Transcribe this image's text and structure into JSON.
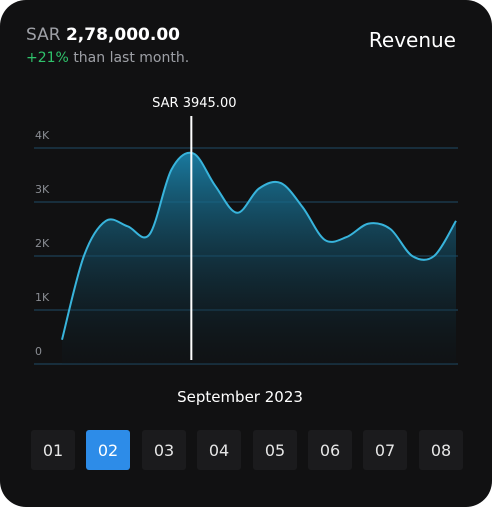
{
  "header": {
    "currency": "SAR",
    "amount": "2,78,000.00",
    "change": "+21%",
    "change_suffix": "than last month.",
    "title": "Revenue"
  },
  "colors": {
    "background": "#111112",
    "accent": "#2d8ce8",
    "line": "#38b4dc",
    "positive": "#2fc26b"
  },
  "tooltip": {
    "label": "SAR 3945.00"
  },
  "chart_data": {
    "type": "area",
    "ytick_labels": [
      "4K",
      "3K",
      "2K",
      "1K",
      "0"
    ],
    "ylim": [
      0,
      4000
    ],
    "x": [
      0,
      1,
      2,
      3,
      4,
      5,
      6,
      7,
      8,
      9,
      10,
      11,
      12,
      13,
      14,
      15,
      16,
      17,
      18
    ],
    "values": [
      450,
      2000,
      2650,
      2550,
      2400,
      3600,
      3900,
      3300,
      2800,
      3250,
      3350,
      2900,
      2300,
      2350,
      2600,
      2500,
      2000,
      2000,
      2650
    ],
    "highlight": {
      "index": 6,
      "value": 3945
    },
    "grid": true
  },
  "period": {
    "label": "September 2023"
  },
  "days": [
    "01",
    "02",
    "03",
    "04",
    "05",
    "06",
    "07",
    "08"
  ],
  "selected_day": "02"
}
